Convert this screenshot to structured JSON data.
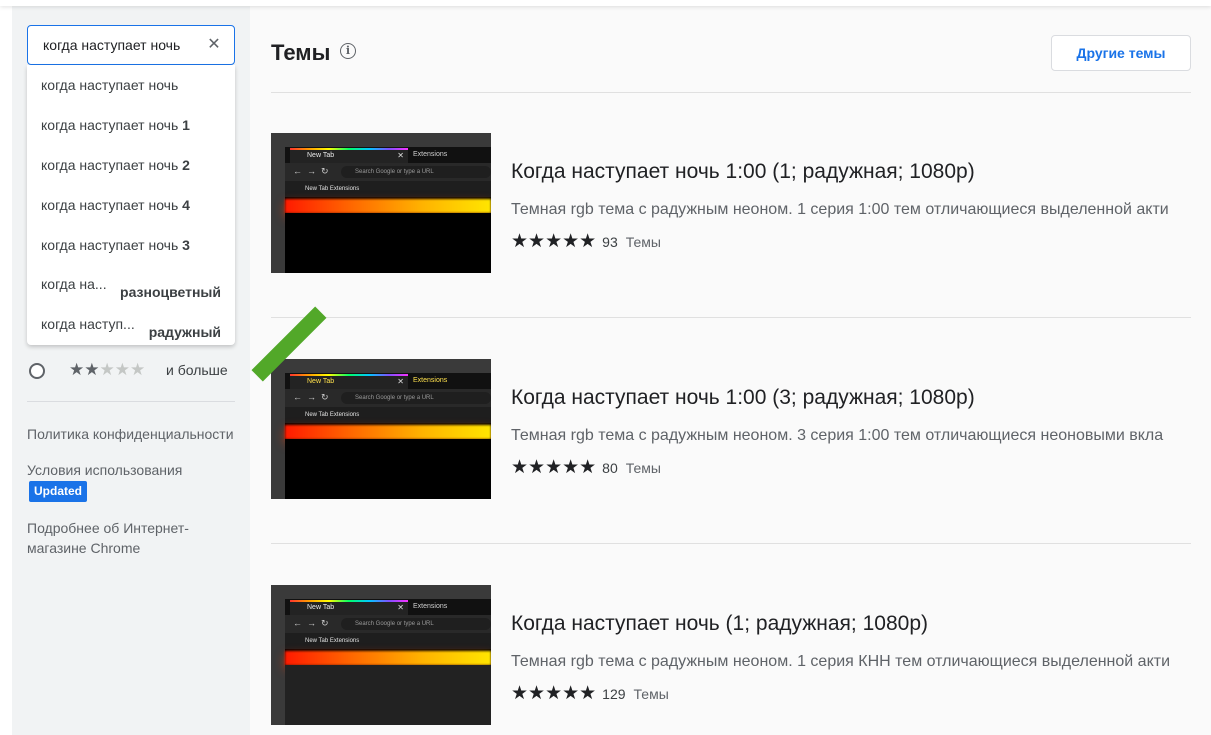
{
  "search": {
    "value": "когда наступает ночь",
    "clear_icon": "close-icon",
    "suggestions": [
      {
        "base": "когда наступает ночь",
        "bold": ""
      },
      {
        "base": "когда наступает ночь ",
        "bold": "1"
      },
      {
        "base": "когда наступает ночь ",
        "bold": "2"
      },
      {
        "base": "когда наступает ночь ",
        "bold": "4"
      },
      {
        "base": "когда наступает ночь ",
        "bold": "3"
      },
      {
        "base": "когда на...",
        "bold": "разноцветный"
      },
      {
        "base": "когда наступ...",
        "bold": "радужный"
      }
    ]
  },
  "filters": {
    "rating_label": "и больше",
    "rating_stars": 2
  },
  "sidebar_links": {
    "privacy": "Политика конфиденциальности",
    "terms": "Условия использования",
    "updated_badge": "Updated",
    "about": "Подробнее об Интернет-магазине Chrome"
  },
  "main": {
    "title": "Темы",
    "info_icon": "info-icon",
    "other_themes_button": "Другие темы",
    "items": [
      {
        "title": "Когда наступает ночь 1:00 (1; радужная; 1080p)",
        "description": "Темная rgb тема с радужным неоном. 1 серия 1:00 тем отличающиеся выделенной акти",
        "rating": 5,
        "rating_count": "93",
        "category": "Темы"
      },
      {
        "title": "Когда наступает ночь 1:00 (3; радужная; 1080p)",
        "description": "Темная rgb тема с радужным неоном. 3 серия 1:00 тем отличающиеся неоновыми вкла",
        "rating": 5,
        "rating_count": "80",
        "category": "Темы"
      },
      {
        "title": "Когда наступает ночь (1; радужная; 1080p)",
        "description": "Темная rgb тема с радужным неоном. 1 серия КНН тем отличающиеся выделенной акти",
        "rating": 5,
        "rating_count": "129",
        "category": "Темы"
      }
    ]
  },
  "thumbnail_text": {
    "tab": "New Tab",
    "tab2": "Extensions",
    "url_placeholder": "Search Google or type a URL",
    "bookmarks": "New Tab    Extensions"
  },
  "colors": {
    "accent": "#1a73e8",
    "ribbon": "#52a829",
    "sidebar_bg": "#f1f3f4",
    "main_bg": "#fafafa"
  }
}
